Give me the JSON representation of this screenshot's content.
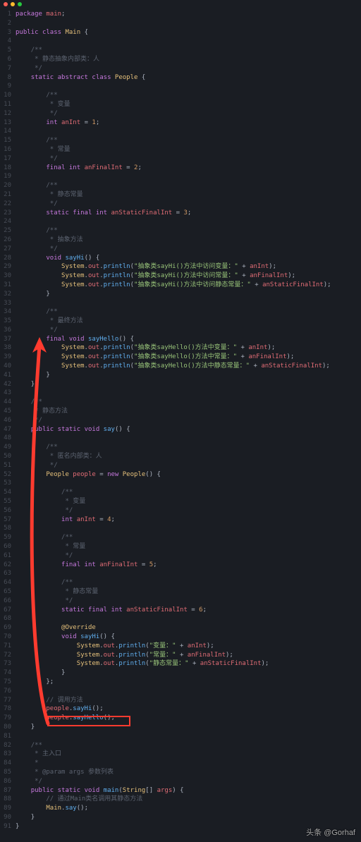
{
  "watermark": "头条 @Gorhaf",
  "lines": [
    {
      "n": 1,
      "html": "<span class='kw'>package</span> <span class='fld'>main</span><span class='pun'>;</span>"
    },
    {
      "n": 2,
      "html": ""
    },
    {
      "n": 3,
      "html": "<span class='kw'>public</span> <span class='kw'>class</span> <span class='cls'>Main</span> <span class='pun'>{</span>"
    },
    {
      "n": 4,
      "html": ""
    },
    {
      "n": 5,
      "html": "    <span class='cmt'>/**</span>"
    },
    {
      "n": 6,
      "html": "    <span class='cmt'> * 静态抽象内部类：人</span>"
    },
    {
      "n": 7,
      "html": "    <span class='cmt'> */</span>"
    },
    {
      "n": 8,
      "html": "    <span class='kw'>static</span> <span class='kw'>abstract</span> <span class='kw'>class</span> <span class='cls'>People</span> <span class='pun'>{</span>"
    },
    {
      "n": 9,
      "html": ""
    },
    {
      "n": 10,
      "html": "        <span class='cmt'>/**</span>"
    },
    {
      "n": 11,
      "html": "        <span class='cmt'> * 变量</span>"
    },
    {
      "n": 12,
      "html": "        <span class='cmt'> */</span>"
    },
    {
      "n": 13,
      "html": "        <span class='kw'>int</span> <span class='fld'>anInt</span> <span class='pun'>=</span> <span class='num'>1</span><span class='pun'>;</span>"
    },
    {
      "n": 14,
      "html": ""
    },
    {
      "n": 15,
      "html": "        <span class='cmt'>/**</span>"
    },
    {
      "n": 16,
      "html": "        <span class='cmt'> * 常量</span>"
    },
    {
      "n": 17,
      "html": "        <span class='cmt'> */</span>"
    },
    {
      "n": 18,
      "html": "        <span class='kw'>final</span> <span class='kw'>int</span> <span class='fld'>anFinalInt</span> <span class='pun'>=</span> <span class='num'>2</span><span class='pun'>;</span>"
    },
    {
      "n": 19,
      "html": ""
    },
    {
      "n": 20,
      "html": "        <span class='cmt'>/**</span>"
    },
    {
      "n": 21,
      "html": "        <span class='cmt'> * 静态常量</span>"
    },
    {
      "n": 22,
      "html": "        <span class='cmt'> */</span>"
    },
    {
      "n": 23,
      "html": "        <span class='kw'>static</span> <span class='kw'>final</span> <span class='kw'>int</span> <span class='fld'>anStaticFinalInt</span> <span class='pun'>=</span> <span class='num'>3</span><span class='pun'>;</span>"
    },
    {
      "n": 24,
      "html": ""
    },
    {
      "n": 25,
      "html": "        <span class='cmt'>/**</span>"
    },
    {
      "n": 26,
      "html": "        <span class='cmt'> * 抽象方法</span>"
    },
    {
      "n": 27,
      "html": "        <span class='cmt'> */</span>"
    },
    {
      "n": 28,
      "html": "        <span class='kw'>void</span> <span class='mth'>sayHi</span><span class='pun'>() {</span>"
    },
    {
      "n": 29,
      "html": "            <span class='cls'>System</span><span class='pun'>.</span><span class='fld'>out</span><span class='pun'>.</span><span class='mth'>println</span><span class='pun'>(</span><span class='str'>\"抽象类sayHi()方法中访问变量：\"</span> <span class='pun'>+</span> <span class='fld'>anInt</span><span class='pun'>);</span>"
    },
    {
      "n": 30,
      "html": "            <span class='cls'>System</span><span class='pun'>.</span><span class='fld'>out</span><span class='pun'>.</span><span class='mth'>println</span><span class='pun'>(</span><span class='str'>\"抽象类sayHi()方法中访问常量：\"</span> <span class='pun'>+</span> <span class='fld'>anFinalInt</span><span class='pun'>);</span>"
    },
    {
      "n": 31,
      "html": "            <span class='cls'>System</span><span class='pun'>.</span><span class='fld'>out</span><span class='pun'>.</span><span class='mth'>println</span><span class='pun'>(</span><span class='str'>\"抽象类sayHi()方法中访问静态常量：\"</span> <span class='pun'>+</span> <span class='fld'>anStaticFinalInt</span><span class='pun'>);</span>"
    },
    {
      "n": 32,
      "html": "        <span class='pun'>}</span>"
    },
    {
      "n": 33,
      "html": ""
    },
    {
      "n": 34,
      "html": "        <span class='cmt'>/**</span>"
    },
    {
      "n": 35,
      "html": "        <span class='cmt'> * 最终方法</span>"
    },
    {
      "n": 36,
      "html": "        <span class='cmt'> */</span>"
    },
    {
      "n": 37,
      "html": "        <span class='kw'>final</span> <span class='kw'>void</span> <span class='mth'>sayHello</span><span class='pun'>() {</span>"
    },
    {
      "n": 38,
      "html": "            <span class='cls'>System</span><span class='pun'>.</span><span class='fld'>out</span><span class='pun'>.</span><span class='mth'>println</span><span class='pun'>(</span><span class='str'>\"抽象类sayHello()方法中变量：\"</span> <span class='pun'>+</span> <span class='fld'>anInt</span><span class='pun'>);</span>"
    },
    {
      "n": 39,
      "html": "            <span class='cls'>System</span><span class='pun'>.</span><span class='fld'>out</span><span class='pun'>.</span><span class='mth'>println</span><span class='pun'>(</span><span class='str'>\"抽象类sayHello()方法中常量：\"</span> <span class='pun'>+</span> <span class='fld'>anFinalInt</span><span class='pun'>);</span>"
    },
    {
      "n": 40,
      "html": "            <span class='cls'>System</span><span class='pun'>.</span><span class='fld'>out</span><span class='pun'>.</span><span class='mth'>println</span><span class='pun'>(</span><span class='str'>\"抽象类sayHello()方法中静态常量：\"</span> <span class='pun'>+</span> <span class='fld'>anStaticFinalInt</span><span class='pun'>);</span>"
    },
    {
      "n": 41,
      "html": "        <span class='pun'>}</span>"
    },
    {
      "n": 42,
      "html": "    <span class='pun'>}</span>"
    },
    {
      "n": 43,
      "html": ""
    },
    {
      "n": 44,
      "html": "    <span class='cmt'>/**</span>"
    },
    {
      "n": 45,
      "html": "    <span class='cmt'> * 静态方法</span>"
    },
    {
      "n": 46,
      "html": "    <span class='cmt'> */</span>"
    },
    {
      "n": 47,
      "html": "    <span class='kw'>public</span> <span class='kw'>static</span> <span class='kw'>void</span> <span class='mth'>say</span><span class='pun'>() {</span>"
    },
    {
      "n": 48,
      "html": ""
    },
    {
      "n": 49,
      "html": "        <span class='cmt'>/**</span>"
    },
    {
      "n": 50,
      "html": "        <span class='cmt'> * 匿名内部类：人</span>"
    },
    {
      "n": 51,
      "html": "        <span class='cmt'> */</span>"
    },
    {
      "n": 52,
      "html": "        <span class='cls'>People</span> <span class='fld'>people</span> <span class='pun'>=</span> <span class='kw'>new</span> <span class='cls'>People</span><span class='pun'>() {</span>"
    },
    {
      "n": 53,
      "html": ""
    },
    {
      "n": 54,
      "html": "            <span class='cmt'>/**</span>"
    },
    {
      "n": 55,
      "html": "            <span class='cmt'> * 变量</span>"
    },
    {
      "n": 56,
      "html": "            <span class='cmt'> */</span>"
    },
    {
      "n": 57,
      "html": "            <span class='kw'>int</span> <span class='fld'>anInt</span> <span class='pun'>=</span> <span class='num'>4</span><span class='pun'>;</span>"
    },
    {
      "n": 58,
      "html": ""
    },
    {
      "n": 59,
      "html": "            <span class='cmt'>/**</span>"
    },
    {
      "n": 60,
      "html": "            <span class='cmt'> * 常量</span>"
    },
    {
      "n": 61,
      "html": "            <span class='cmt'> */</span>"
    },
    {
      "n": 62,
      "html": "            <span class='kw'>final</span> <span class='kw'>int</span> <span class='fld'>anFinalInt</span> <span class='pun'>=</span> <span class='num'>5</span><span class='pun'>;</span>"
    },
    {
      "n": 63,
      "html": ""
    },
    {
      "n": 64,
      "html": "            <span class='cmt'>/**</span>"
    },
    {
      "n": 65,
      "html": "            <span class='cmt'> * 静态常量</span>"
    },
    {
      "n": 66,
      "html": "            <span class='cmt'> */</span>"
    },
    {
      "n": 67,
      "html": "            <span class='kw'>static</span> <span class='kw'>final</span> <span class='kw'>int</span> <span class='fld'>anStaticFinalInt</span> <span class='pun'>=</span> <span class='num'>6</span><span class='pun'>;</span>"
    },
    {
      "n": 68,
      "html": ""
    },
    {
      "n": 69,
      "html": "            <span class='ann'>@Override</span>"
    },
    {
      "n": 70,
      "html": "            <span class='kw'>void</span> <span class='mth'>sayHi</span><span class='pun'>() {</span>"
    },
    {
      "n": 71,
      "html": "                <span class='cls'>System</span><span class='pun'>.</span><span class='fld'>out</span><span class='pun'>.</span><span class='mth'>println</span><span class='pun'>(</span><span class='str'>\"变量：\"</span> <span class='pun'>+</span> <span class='fld'>anInt</span><span class='pun'>);</span>"
    },
    {
      "n": 72,
      "html": "                <span class='cls'>System</span><span class='pun'>.</span><span class='fld'>out</span><span class='pun'>.</span><span class='mth'>println</span><span class='pun'>(</span><span class='str'>\"常量：\"</span> <span class='pun'>+</span> <span class='fld'>anFinalInt</span><span class='pun'>);</span>"
    },
    {
      "n": 73,
      "html": "                <span class='cls'>System</span><span class='pun'>.</span><span class='fld'>out</span><span class='pun'>.</span><span class='mth'>println</span><span class='pun'>(</span><span class='str'>\"静态常量：\"</span> <span class='pun'>+</span> <span class='fld'>anStaticFinalInt</span><span class='pun'>);</span>"
    },
    {
      "n": 74,
      "html": "            <span class='pun'>}</span>"
    },
    {
      "n": 75,
      "html": "        <span class='pun'>};</span>"
    },
    {
      "n": 76,
      "html": ""
    },
    {
      "n": 77,
      "html": "        <span class='cmt'>// 调用方法</span>"
    },
    {
      "n": 78,
      "html": "        <span class='fld'>people</span><span class='pun'>.</span><span class='mth'>sayHi</span><span class='pun'>();</span>"
    },
    {
      "n": 79,
      "html": "        <span class='fld'>people</span><span class='pun'>.</span><span class='mth'>sayHello</span><span class='pun'>();</span>"
    },
    {
      "n": 80,
      "html": "    <span class='pun'>}</span>"
    },
    {
      "n": 81,
      "html": ""
    },
    {
      "n": 82,
      "html": "    <span class='cmt'>/**</span>"
    },
    {
      "n": 83,
      "html": "    <span class='cmt'> * 主入口</span>"
    },
    {
      "n": 84,
      "html": "    <span class='cmt'> *</span>"
    },
    {
      "n": 85,
      "html": "    <span class='cmt'> * @param args 参数列表</span>"
    },
    {
      "n": 86,
      "html": "    <span class='cmt'> */</span>"
    },
    {
      "n": 87,
      "html": "    <span class='kw'>public</span> <span class='kw'>static</span> <span class='kw'>void</span> <span class='mth'>main</span><span class='pun'>(</span><span class='cls'>String</span><span class='pun'>[]</span> <span class='fld'>args</span><span class='pun'>) {</span>"
    },
    {
      "n": 88,
      "html": "        <span class='cmt'>// 通过Main类名调用其静态方法</span>"
    },
    {
      "n": 89,
      "html": "        <span class='cls'>Main</span><span class='pun'>.</span><span class='mth'>say</span><span class='pun'>();</span>"
    },
    {
      "n": 90,
      "html": "    <span class='pun'>}</span>"
    },
    {
      "n": 91,
      "html": "<span class='pun'>}</span>"
    }
  ]
}
